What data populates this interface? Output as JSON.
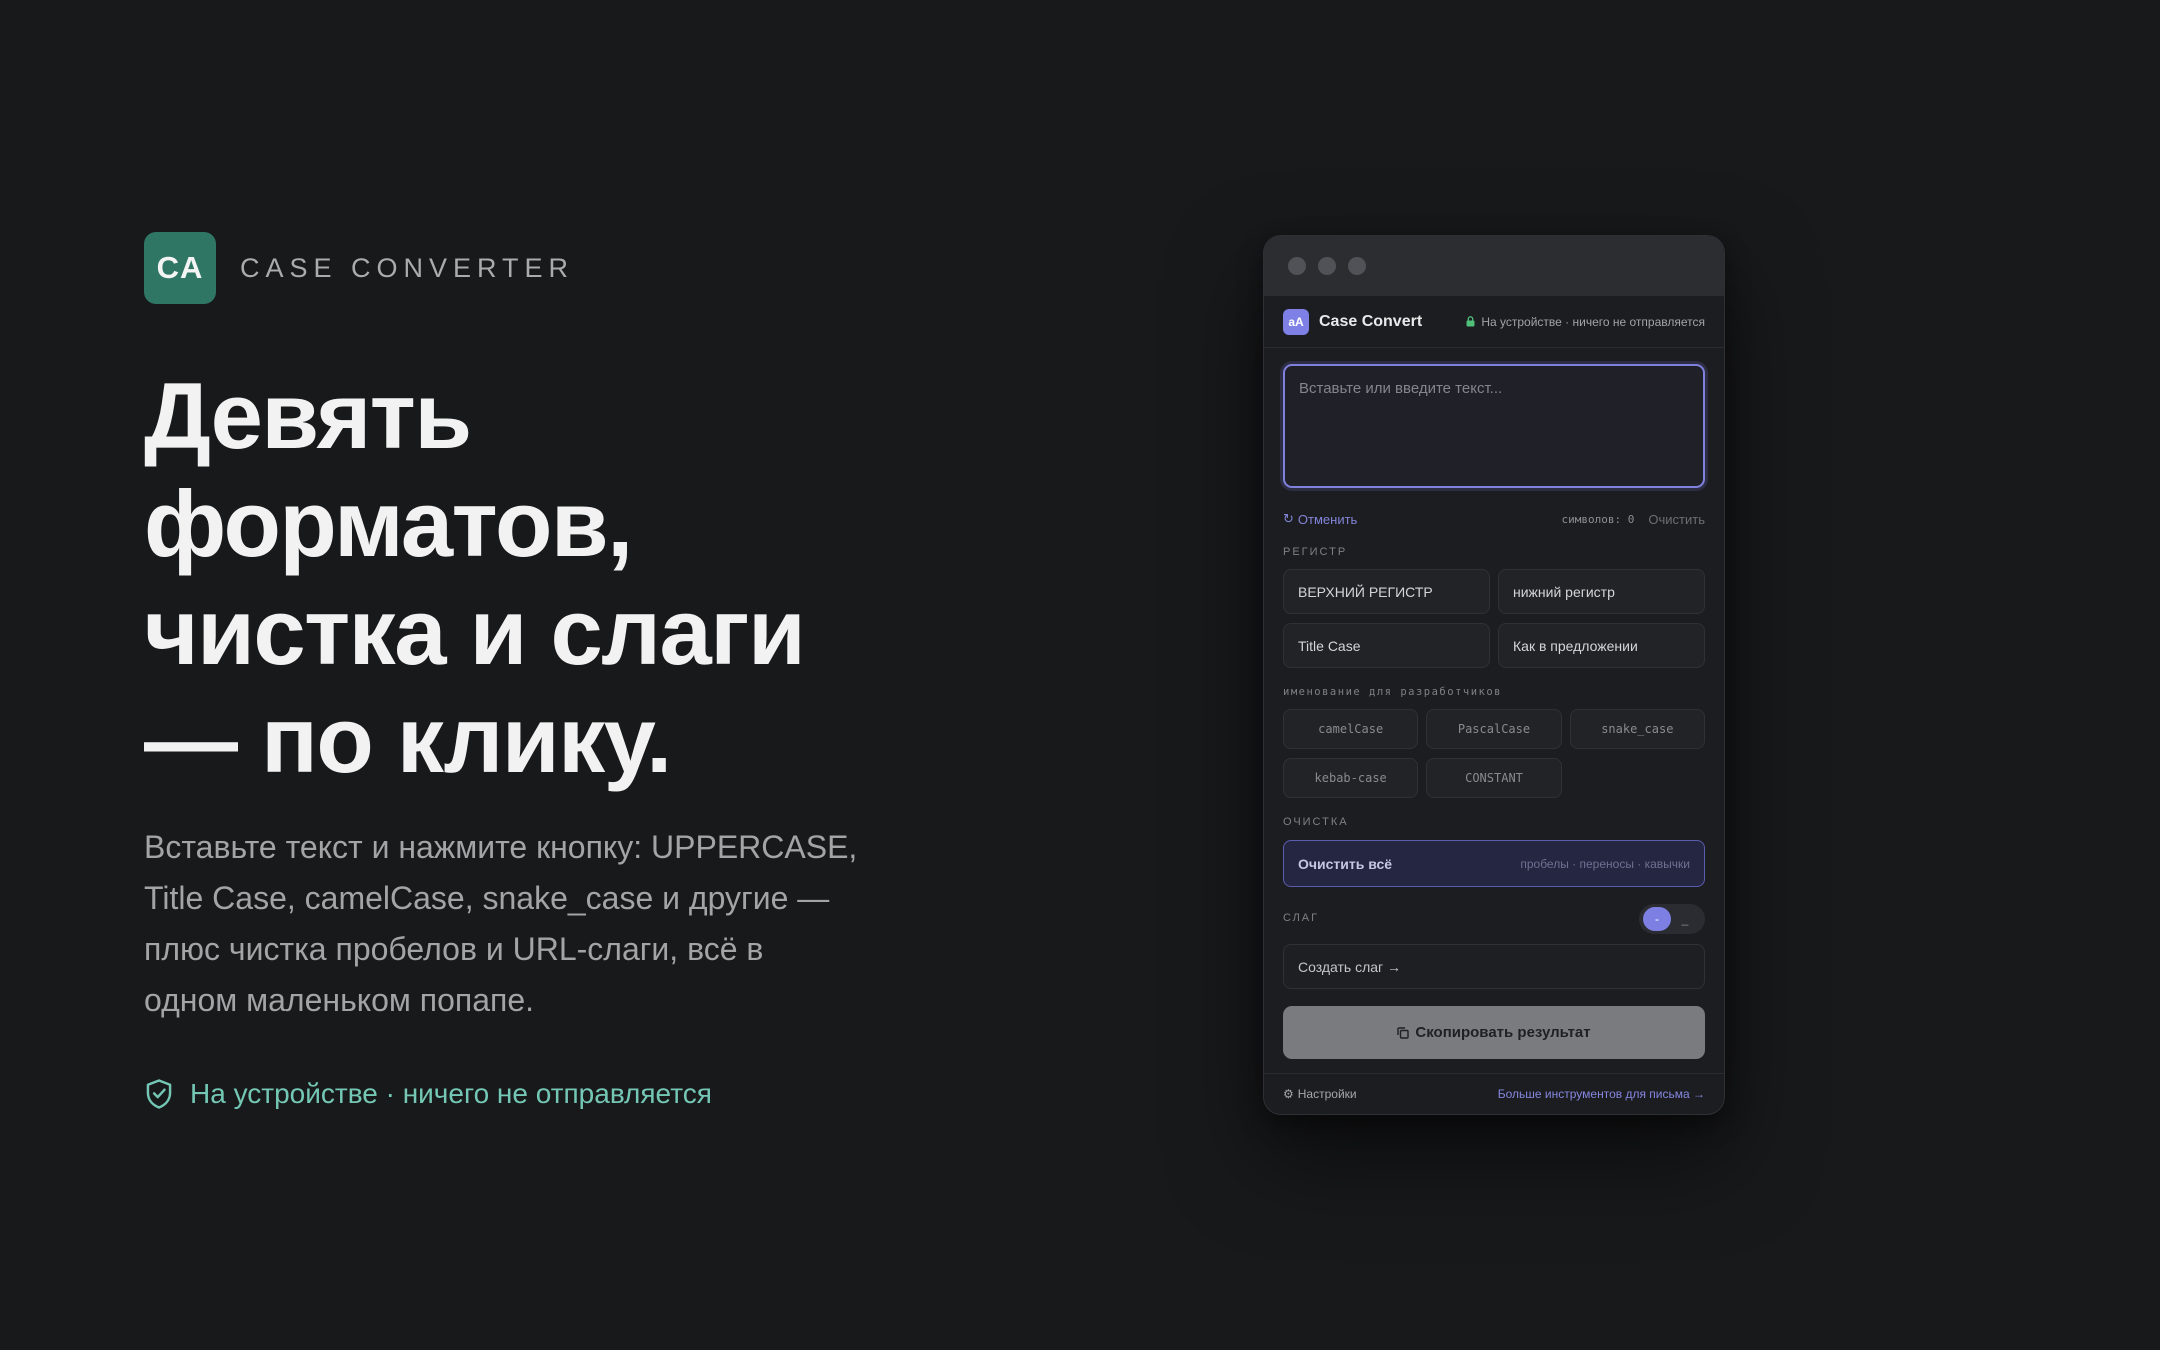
{
  "brand": {
    "logo_text": "CA",
    "name": "CASE CONVERTER"
  },
  "hero": {
    "headline_lines": [
      "Девять",
      "форматов,",
      "чистка и слаги",
      "— по клику."
    ],
    "lead_lines": [
      "Вставьте текст и нажмите кнопку: UPPERCASE,",
      "Title Case, camelCase, snake_case и другие —",
      "плюс чистка пробелов и URL-слаги, всё в",
      "одном маленьком попапе."
    ],
    "privacy_note": "На устройстве · ничего не отправляется"
  },
  "app": {
    "icon_text": "aA",
    "title": "Case Convert",
    "badge": "На устройстве · ничего не отправляется",
    "input": {
      "value": "",
      "placeholder": "Вставьте или введите текст..."
    },
    "undo_label": "Отменить",
    "counter_label": "символов: 0",
    "clear_label": "Очистить",
    "case_section": {
      "label": "РЕГИСТР",
      "buttons": [
        "ВЕРХНИЙ РЕГИСТР",
        "нижний регистр",
        "Title Case",
        "Как в предложении"
      ]
    },
    "dev_section": {
      "label": "именование для разработчиков",
      "buttons": [
        "camelCase",
        "PascalCase",
        "snake_case",
        "kebab-case",
        "CONSTANT"
      ]
    },
    "clean_section": {
      "label": "ОЧИСТКА",
      "button_label": "Очистить всё",
      "button_hint": "пробелы · переносы · кавычки"
    },
    "slug_section": {
      "label": "СЛАГ",
      "toggle_options": [
        "-",
        "_"
      ],
      "toggle_selected": "-",
      "button_label": "Создать слаг →"
    },
    "copy_label": "Скопировать результат",
    "footer": {
      "settings_label": "Настройки",
      "more_link": "Больше инструментов для письма →"
    }
  },
  "colors": {
    "background": "#18191b",
    "brand": "#2f7664",
    "accent": "#7e80e6",
    "privacy": "#74c7b5"
  }
}
